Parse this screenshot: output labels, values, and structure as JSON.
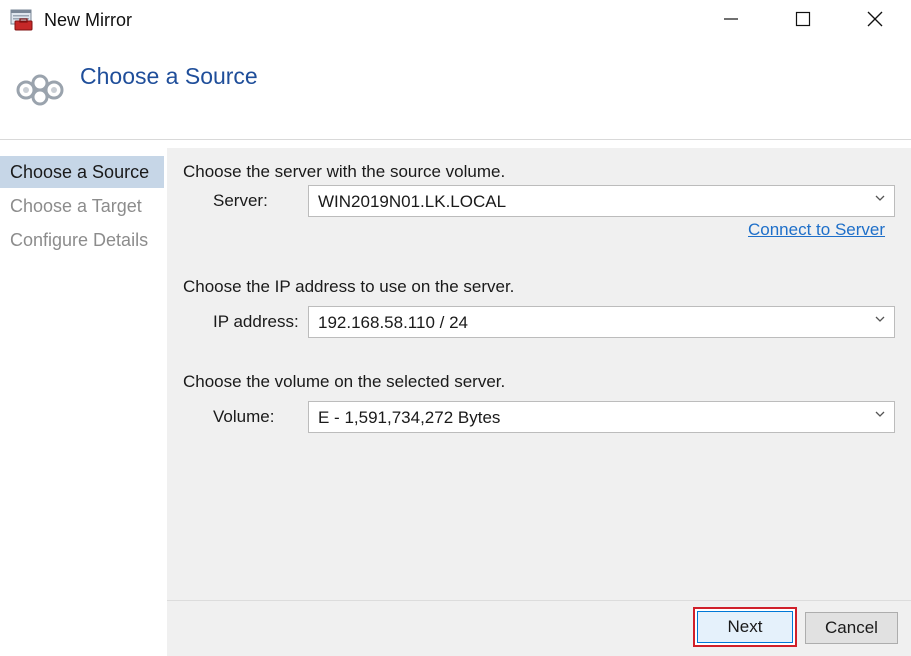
{
  "window": {
    "title": "New Mirror"
  },
  "header": {
    "title": "Choose a Source"
  },
  "nav": {
    "items": [
      {
        "label": "Choose a Source",
        "active": true
      },
      {
        "label": "Choose a Target",
        "active": false
      },
      {
        "label": "Configure Details",
        "active": false
      }
    ]
  },
  "content": {
    "server_prompt": "Choose the server with the source volume.",
    "server_label": "Server:",
    "server_value": "WIN2019N01.LK.LOCAL",
    "connect_link": "Connect to Server",
    "ip_prompt": "Choose the IP address to use on the server.",
    "ip_label": "IP address:",
    "ip_value": "192.168.58.110 / 24",
    "volume_prompt": "Choose the volume on the selected server.",
    "volume_label": "Volume:",
    "volume_value": "E - 1,591,734,272 Bytes"
  },
  "footer": {
    "next_label": "Next",
    "cancel_label": "Cancel"
  },
  "icons": {
    "app": "app-window-icon",
    "header": "mirror-icon",
    "minimize": "minimize-icon",
    "maximize": "maximize-icon",
    "close": "close-icon",
    "dropdown": "chevron-down-icon"
  },
  "colors": {
    "header_title": "#1f4e9a",
    "nav_active_bg": "#c6d6e7",
    "link": "#1e6fc9",
    "highlight_border": "#d0202a"
  }
}
